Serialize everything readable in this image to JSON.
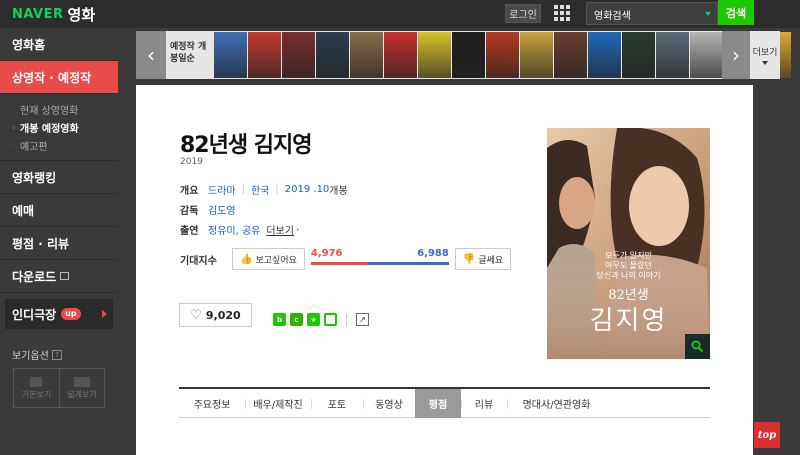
{
  "header": {
    "logo_brand": "NAVER",
    "logo_service": "영화",
    "login_label": "로그인",
    "apps_icon": "grid-icon",
    "search_select": "영화검색",
    "search_button": "검색"
  },
  "sidebar": {
    "items": [
      {
        "label": "영화홈"
      },
      {
        "label": "상영작 · 예정작"
      }
    ],
    "sub_items": [
      {
        "label": "현재 상영영화"
      },
      {
        "label": "개봉 예정영화"
      },
      {
        "label": "예고편"
      }
    ],
    "items2": [
      {
        "label": "영화랭킹"
      },
      {
        "label": "예매"
      },
      {
        "label": "평점 · 리뷰"
      },
      {
        "label": "다운로드"
      }
    ],
    "indie": {
      "label": "인디극장",
      "badge": "up"
    },
    "view_options": {
      "label": "보기옵션",
      "help": "?",
      "basic": "기본보기",
      "wide": "넓게보기"
    }
  },
  "strip": {
    "label": "예정작 개봉일순",
    "more_label": "더보기",
    "poster_colors": [
      "#3d6fb8",
      "#c33a30",
      "#7a2f2f",
      "#2c3d4d",
      "#8a6c4a",
      "#c7302d",
      "#d7c12a",
      "#1f1f1f",
      "#b43a1e",
      "#c9a23c",
      "#6b3e2f",
      "#1f6ab8",
      "#2a3b2e",
      "#5d6a7a",
      "#b5b5b5",
      "#d44a3a",
      "#e0a830"
    ]
  },
  "movie": {
    "title": "82년생 김지영",
    "year": "2019",
    "overview_key": "개요",
    "genre": "드라마",
    "country": "한국",
    "release_date": "2019 .10",
    "release_suffix": "개봉",
    "director_key": "감독",
    "director": "김도영",
    "cast_key": "출연",
    "cast": "정유미, 공유",
    "cast_more": "더보기",
    "anticipation_key": "기대지수",
    "want_label": "보고싶어요",
    "want_count": "4,976",
    "notwant_count": "6,988",
    "notwant_label": "글쎄요",
    "want_ratio": 0.416,
    "like_count": "9,020"
  },
  "poster": {
    "tagline1": "모두가 알지만",
    "tagline2": "아무도 몰랐던",
    "tagline3": "당신과 나의 이야기",
    "title_small": "82년생",
    "title_big": "김지영"
  },
  "tabs": [
    {
      "label": "주요정보"
    },
    {
      "label": "배우/제작진"
    },
    {
      "label": "포토"
    },
    {
      "label": "동영상"
    },
    {
      "label": "평점",
      "active": true
    },
    {
      "label": "리뷰"
    },
    {
      "label": "명대사/연관영화"
    }
  ],
  "top_button": "top"
}
